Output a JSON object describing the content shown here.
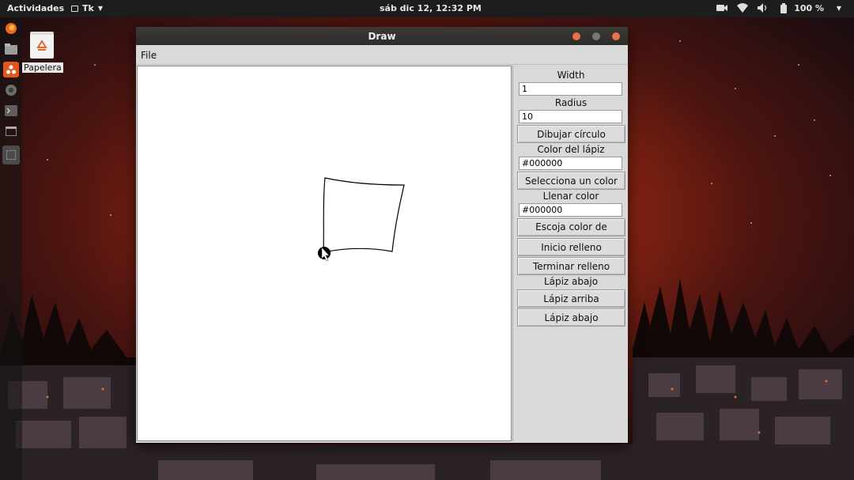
{
  "topbar": {
    "activities": "Actividades",
    "app_name": "Tk",
    "clock": "sáb dic 12, 12:32 PM",
    "battery": "100 %"
  },
  "desktop": {
    "trash_label": "Papelera"
  },
  "window": {
    "title": "Draw",
    "menu": {
      "file": "File"
    }
  },
  "panel": {
    "width_label": "Width",
    "width_value": "1",
    "radius_label": "Radius",
    "radius_value": "10",
    "draw_circle_button": "Dibujar círculo",
    "pen_color_label": "Color del lápiz",
    "pen_color_value": "#000000",
    "select_color_button": "Selecciona un color",
    "fill_color_label": "Llenar color",
    "fill_color_value": "#000000",
    "choose_fill_button": "Escoja color de relleno",
    "start_fill_button": "Inicio relleno",
    "end_fill_button": "Terminar relleno",
    "pen_state_label": "Lápiz abajo",
    "pen_up_button": "Lápiz arriba",
    "pen_down_button": "Lápiz abajo"
  },
  "colors": {
    "window_close": "#e8734a",
    "panel_bg": "#d9d9d9",
    "canvas_bg": "#ffffff"
  }
}
